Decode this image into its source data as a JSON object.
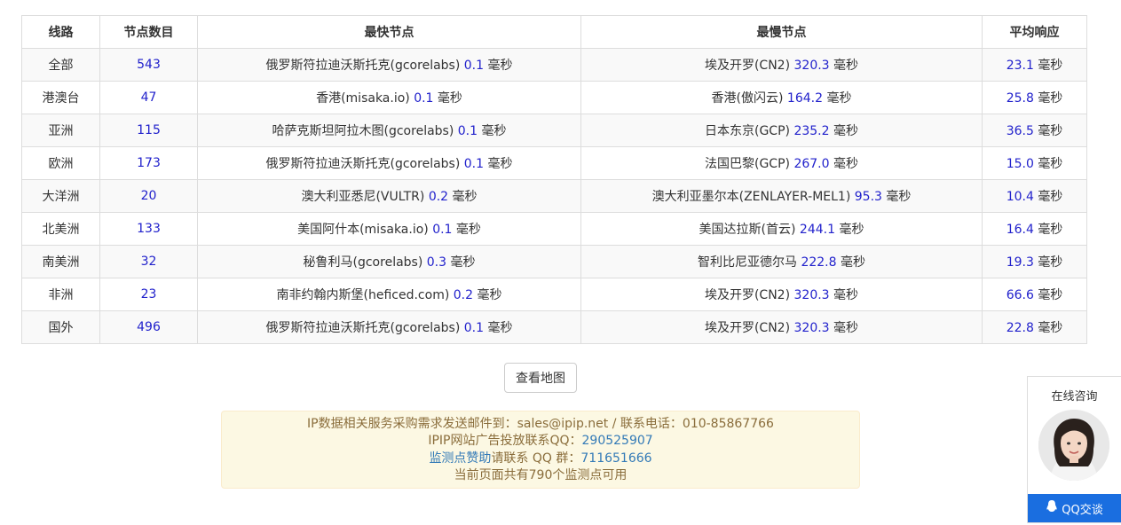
{
  "table": {
    "headers": [
      "线路",
      "节点数目",
      "最快节点",
      "最慢节点",
      "平均响应"
    ],
    "unit": "毫秒",
    "rows": [
      {
        "route": "全部",
        "count": "543",
        "fast_name": "俄罗斯符拉迪沃斯托克(gcorelabs)",
        "fast_ms": "0.1",
        "slow_name": "埃及开罗(CN2)",
        "slow_ms": "320.3",
        "avg_ms": "23.1"
      },
      {
        "route": "港澳台",
        "count": "47",
        "fast_name": "香港(misaka.io)",
        "fast_ms": "0.1",
        "slow_name": "香港(傲闪云)",
        "slow_ms": "164.2",
        "avg_ms": "25.8"
      },
      {
        "route": "亚洲",
        "count": "115",
        "fast_name": "哈萨克斯坦阿拉木图(gcorelabs)",
        "fast_ms": "0.1",
        "slow_name": "日本东京(GCP)",
        "slow_ms": "235.2",
        "avg_ms": "36.5"
      },
      {
        "route": "欧洲",
        "count": "173",
        "fast_name": "俄罗斯符拉迪沃斯托克(gcorelabs)",
        "fast_ms": "0.1",
        "slow_name": "法国巴黎(GCP)",
        "slow_ms": "267.0",
        "avg_ms": "15.0"
      },
      {
        "route": "大洋洲",
        "count": "20",
        "fast_name": "澳大利亚悉尼(VULTR)",
        "fast_ms": "0.2",
        "slow_name": "澳大利亚墨尔本(ZENLAYER-MEL1)",
        "slow_ms": "95.3",
        "avg_ms": "10.4"
      },
      {
        "route": "北美洲",
        "count": "133",
        "fast_name": "美国阿什本(misaka.io)",
        "fast_ms": "0.1",
        "slow_name": "美国达拉斯(首云)",
        "slow_ms": "244.1",
        "avg_ms": "16.4"
      },
      {
        "route": "南美洲",
        "count": "32",
        "fast_name": "秘鲁利马(gcorelabs)",
        "fast_ms": "0.3",
        "slow_name": "智利比尼亚德尔马",
        "slow_ms": "222.8",
        "avg_ms": "19.3"
      },
      {
        "route": "非洲",
        "count": "23",
        "fast_name": "南非约翰内斯堡(heficed.com)",
        "fast_ms": "0.2",
        "slow_name": "埃及开罗(CN2)",
        "slow_ms": "320.3",
        "avg_ms": "66.6"
      },
      {
        "route": "国外",
        "count": "496",
        "fast_name": "俄罗斯符拉迪沃斯托克(gcorelabs)",
        "fast_ms": "0.1",
        "slow_name": "埃及开罗(CN2)",
        "slow_ms": "320.3",
        "avg_ms": "22.8"
      }
    ]
  },
  "map_button": "查看地图",
  "notice": {
    "line1_prefix": "IP数据相关服务采购需求发送邮件到：",
    "email": "sales@ipip.net",
    "line1_mid": " / 联系电话：",
    "phone": "010-85867766",
    "line2_prefix": "IPIP网站广告投放联系QQ：",
    "ad_qq": "290525907",
    "sponsor_link": "监测点赞助",
    "line3_mid": "请联系 QQ 群：",
    "group_qq": "711651666",
    "line4": "当前页面共有790个监测点可用"
  },
  "chat": {
    "title": "在线咨询",
    "button": "QQ交谈"
  },
  "colors": {
    "number": "#2222cc",
    "notice_bg": "#fcf8e3",
    "notice_text": "#8a6d3b",
    "link": "#337ab7",
    "qq_button": "#1a6ee0"
  }
}
